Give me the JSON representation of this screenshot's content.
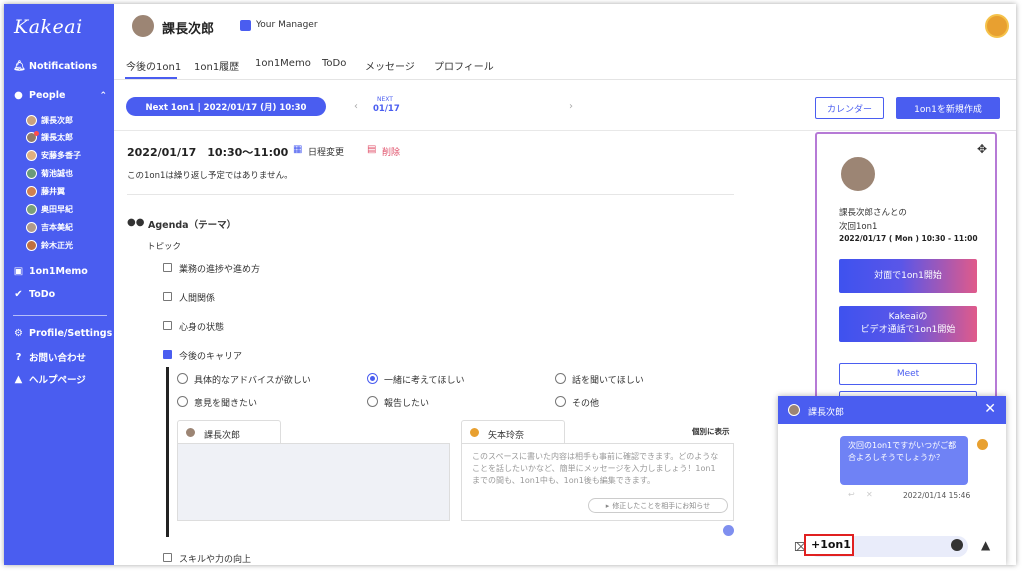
{
  "app": {
    "logo": "Kakeai"
  },
  "sidebar": {
    "notifications": "Notifications",
    "people": "People",
    "people_list": [
      "課長次郎",
      "課長太郎",
      "安藤多香子",
      "菊池誠也",
      "藤井翼",
      "奥田早紀",
      "吉本美紀",
      "鈴木正光"
    ],
    "memo": "1on1Memo",
    "todo": "ToDo",
    "profile": "Profile/Settings",
    "contact": "お問い合わせ",
    "help": "ヘルプページ"
  },
  "header": {
    "name": "課長次郎",
    "role": "Your Manager",
    "tabs": [
      "今後の1on1",
      "1on1履歴",
      "1on1Memo",
      "ToDo",
      "メッセージ",
      "プロフィール"
    ]
  },
  "toolbar": {
    "next_pill": "Next 1on1 | 2022/01/17 (月) 10:30",
    "next_small": "NEXT",
    "next_date": "01/17",
    "calendar": "カレンダー",
    "create": "1on1を新規作成"
  },
  "meeting": {
    "datetime": "2022/01/17　10:30〜11:00",
    "reschedule": "日程変更",
    "delete": "削除",
    "note": "この1on1は繰り返し予定ではありません。",
    "agenda_title": "Agenda（テーマ）",
    "topic_label": "トピック",
    "topics": [
      "業務の進捗や進め方",
      "人間関係",
      "心身の状態",
      "今後のキャリア"
    ],
    "topic_last": "スキルや力の向上",
    "options": [
      "具体的なアドバイスが欲しい",
      "一緒に考えてほしい",
      "話を聞いてほしい",
      "意見を聞きたい",
      "報告したい",
      "その他"
    ],
    "left_tab": "課長次郎",
    "right_tab": "矢本玲奈",
    "individual": "個別に表示",
    "placeholder": "このスペースに書いた内容は相手も事前に確認できます。どのようなことを話したいかなど、簡単にメッセージを入力しましょう！1on1までの間も、1on1中も、1on1後も編集できます。",
    "notify": "修正したことを相手にお知らせ"
  },
  "card": {
    "line1": "課長次郎さんとの",
    "line2": "次回1on1",
    "line3": "2022/01/17 ( Mon ) 10:30 - 11:00",
    "start_face": "対面で1on1開始",
    "video_line1": "Kakeaiの",
    "video_line2": "ビデオ通話で1on1開始",
    "meet": "Meet"
  },
  "chat": {
    "title": "課長次郎",
    "message": "次回の1on1ですがいつがご都合よろしそうでしょうか？",
    "timestamp": "2022/01/14 15:46",
    "input_value": "+1on1"
  },
  "colors": {
    "brand": "#4a5df0",
    "highlight": "#e02020"
  }
}
